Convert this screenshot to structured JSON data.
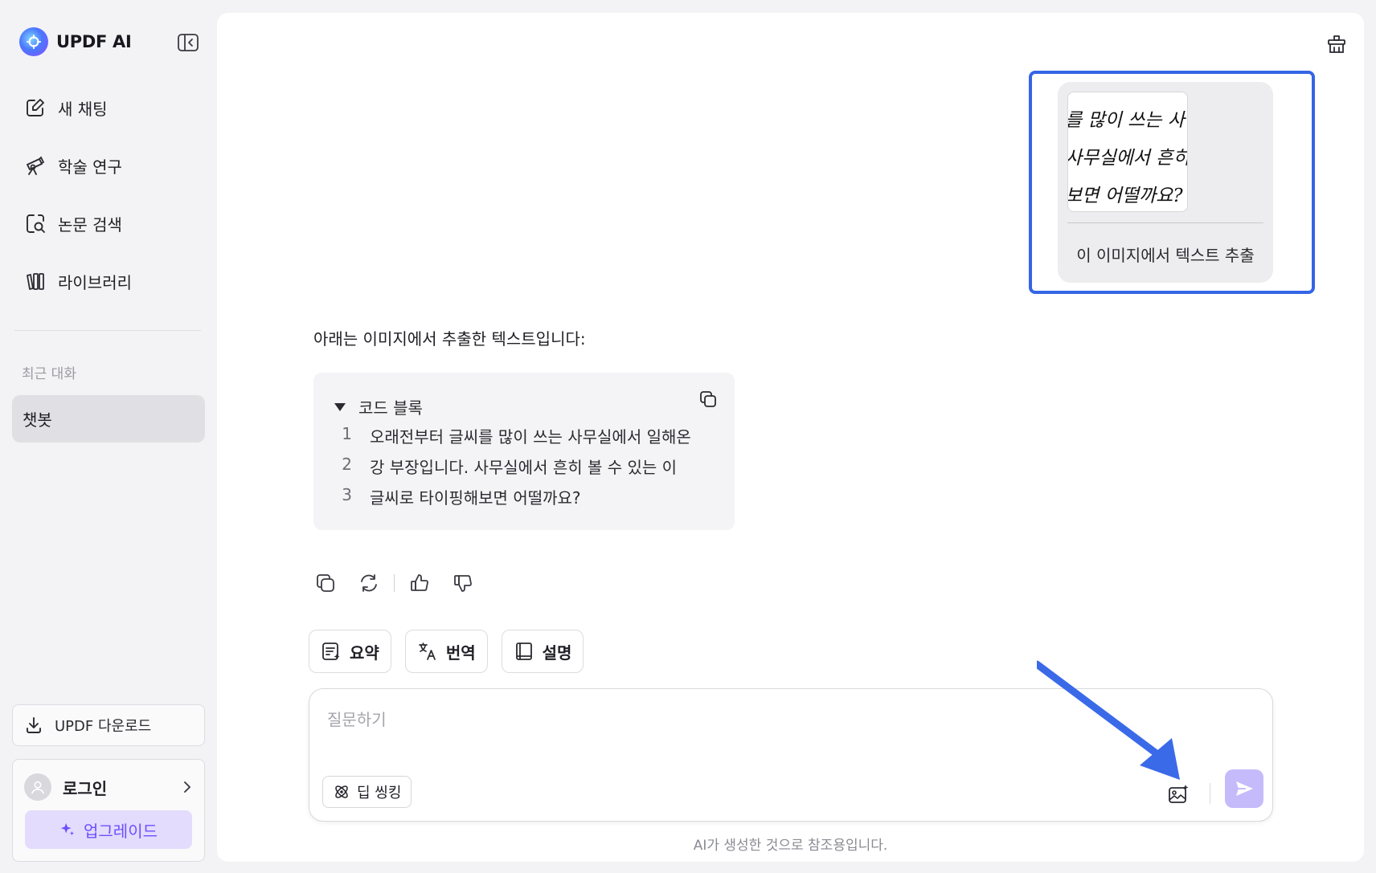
{
  "brand": {
    "name": "UPDF AI"
  },
  "sidebar": {
    "items": [
      {
        "label": "새 채팅",
        "icon": "edit-icon"
      },
      {
        "label": "학술 연구",
        "icon": "telescope-icon"
      },
      {
        "label": "논문 검색",
        "icon": "document-search-icon"
      },
      {
        "label": "라이브러리",
        "icon": "library-icon"
      }
    ],
    "recent_title": "최근 대화",
    "recent_items": [
      {
        "label": "챗봇",
        "selected": true
      }
    ],
    "download_label": "UPDF 다운로드",
    "login_label": "로그인",
    "upgrade_label": "업그레이드"
  },
  "conversation": {
    "user_message": {
      "image_text_lines": [
        "를 많이 쓰는 사",
        "사무실에서 흔히",
        "보면 어떨까요?"
      ],
      "text": "이 이미지에서 텍스트 추출"
    },
    "assistant": {
      "intro": "아래는 이미지에서 추출한 텍스트입니다:",
      "code_block": {
        "title": "코드 블록",
        "lines": [
          {
            "num": "1",
            "text": "오래전부터 글씨를 많이 쓰는 사무실에서 일해온"
          },
          {
            "num": "2",
            "text": "강 부장입니다. 사무실에서 흔히 볼 수 있는 이"
          },
          {
            "num": "3",
            "text": "글씨로 타이핑해보면 어떨까요?"
          }
        ]
      }
    }
  },
  "quick_actions": [
    {
      "label": "요약",
      "icon": "summary-icon"
    },
    {
      "label": "번역",
      "icon": "translate-icon"
    },
    {
      "label": "설명",
      "icon": "book-icon"
    }
  ],
  "input": {
    "placeholder": "질문하기",
    "value": "",
    "deep_thinking_label": "딥 씽킹"
  },
  "disclaimer": "AI가 생성한 것으로 참조용입니다.",
  "colors": {
    "accent": "#6e4fff",
    "highlight_border": "#3465e6",
    "annotation_arrow": "#3a6ae8",
    "send_button": "#c5bbfb"
  }
}
